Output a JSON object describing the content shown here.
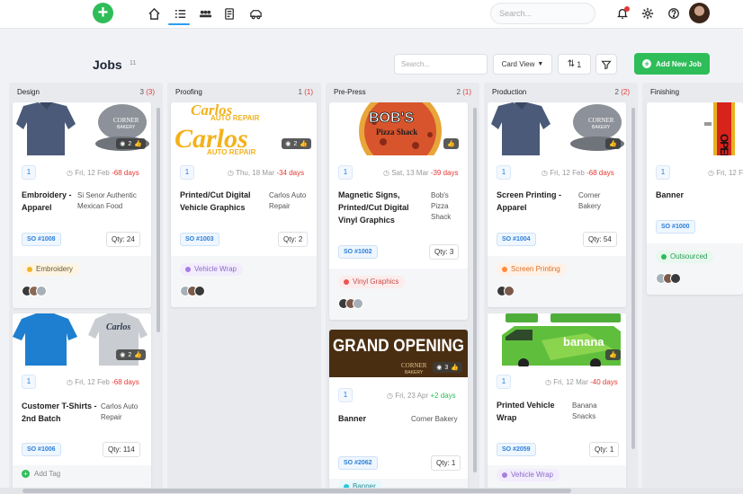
{
  "topbar": {
    "search_placeholder": "Search...",
    "add_icon": "plus-icon",
    "nav_icons": [
      "home-icon",
      "jobs-list-icon",
      "team-icon",
      "invoice-icon",
      "vehicle-icon"
    ],
    "right_icons": [
      "bell-icon",
      "gear-icon",
      "help-icon"
    ]
  },
  "page": {
    "title": "Jobs",
    "count": "11",
    "search_placeholder": "Search...",
    "view_label": "Card View",
    "sort_label": "1",
    "add_job_label": "Add New Job",
    "accent_color": "#2ebd59"
  },
  "columns": [
    {
      "name": "Design",
      "count": "3",
      "late": "(3)"
    },
    {
      "name": "Proofing",
      "count": "1",
      "late": "(1)"
    },
    {
      "name": "Pre-Press",
      "count": "2",
      "late": "(1)"
    },
    {
      "name": "Production",
      "count": "2",
      "late": "(2)"
    },
    {
      "name": "Finishing",
      "count": "",
      "late": ""
    }
  ],
  "cards": {
    "c1": {
      "num": "1",
      "date": "Fri, 12 Feb",
      "delta": "-68 days",
      "title": "Embroidery - Apparel",
      "customer": "Si Senor Authentic Mexican Food",
      "so": "SO #1008",
      "qty": "Qty: 24",
      "tag": "Embroidery",
      "img_count": "2"
    },
    "c2": {
      "num": "1",
      "date": "Fri, 12 Feb",
      "delta": "-68 days",
      "title": "Customer T-Shirts - 2nd Batch",
      "customer": "Carlos Auto Repair",
      "so": "SO #1006",
      "qty": "Qty: 114",
      "add_tag": "Add Tag",
      "img_count": "2",
      "brand": "Carlos"
    },
    "c3": {
      "num": "1",
      "date": "Thu, 18 Mar",
      "delta": "-34 days",
      "title": "Printed/Cut Digital Vehicle Graphics",
      "customer": "Carlos Auto Repair",
      "so": "SO #1003",
      "qty": "Qty: 2",
      "tag": "Vehicle Wrap",
      "img_count": "2",
      "brand1": "Carlos",
      "brand2": "AUTO REPAIR"
    },
    "c4": {
      "num": "1",
      "date": "Sat, 13 Mar",
      "delta": "-39 days",
      "title": "Magnetic Signs, Printed/Cut Digital Vinyl Graphics",
      "customer": "Bob's Pizza Shack",
      "so": "SO #1002",
      "qty": "Qty: 3",
      "tag": "Vinyl Graphics",
      "brand1": "BOB'S",
      "brand2": "Pizza Shack"
    },
    "c5": {
      "num": "1",
      "date": "Fri, 23 Apr",
      "delta": "+2 days",
      "title": "Banner",
      "customer": "Corner Bakery",
      "so": "SO #2062",
      "qty": "Qty: 1",
      "tag": "Banner",
      "img_count": "3",
      "banner": "GRAND OPENING"
    },
    "c6": {
      "num": "1",
      "date": "Fri, 12 Feb",
      "delta": "-68 days",
      "title": "Screen Printing - Apparel",
      "customer": "Corner Bakery",
      "so": "SO #1004",
      "qty": "Qty: 54",
      "tag": "Screen Printing"
    },
    "c7": {
      "num": "1",
      "date": "Fri, 12 Mar",
      "delta": "-40 days",
      "title": "Printed Vehicle Wrap",
      "customer": "Banana Snacks",
      "so": "SO #2059",
      "qty": "Qty: 1",
      "tag": "Vehicle Wrap",
      "brand": "banana"
    },
    "c8": {
      "num": "1",
      "date": "Fri, 12 F",
      "title": "Banner",
      "so": "SO #1000",
      "tag": "Outsourced",
      "banner": "OPEN"
    }
  },
  "tag_colors": {
    "Embroidery": "#f0b429",
    "Vehicle Wrap": "#a67fe0",
    "Vinyl Graphics": "#ef5350",
    "Banner": "#26c6da",
    "Screen Printing": "#ff8a3d",
    "Outsourced": "#2ebd59"
  }
}
